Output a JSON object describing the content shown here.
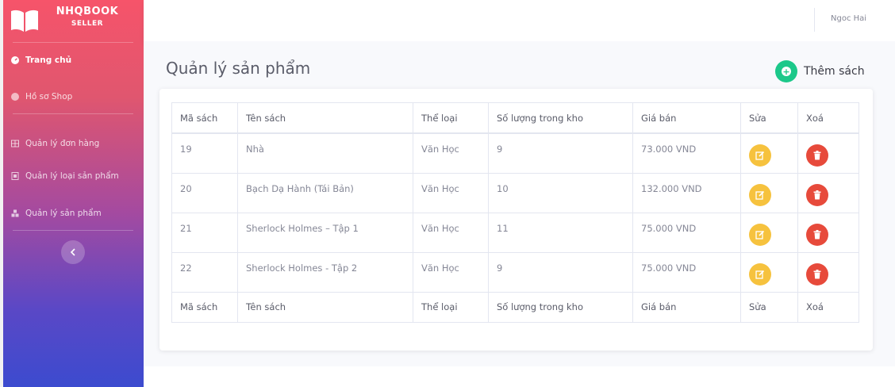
{
  "brand": {
    "name": "NHQBOOK",
    "sub": "SELLER"
  },
  "sidebar": {
    "items": [
      {
        "label": "Trang chủ",
        "icon": "dashboard-icon",
        "active": true
      },
      {
        "label": "Hồ sơ Shop",
        "icon": "profile-icon",
        "active": false
      },
      {
        "label": "Quản lý đơn hàng",
        "icon": "table-icon",
        "active": false
      },
      {
        "label": "Quản lý loại sản phẩm",
        "icon": "category-icon",
        "active": false
      },
      {
        "label": "Quản lý sản phẩm",
        "icon": "boxes-icon",
        "active": false
      }
    ],
    "collapse_icon": "chevron-left-icon"
  },
  "topbar": {
    "user_name": "Ngoc Hai"
  },
  "main": {
    "title": "Quản lý sản phẩm",
    "add_button": "Thêm sách",
    "table": {
      "columns": [
        "Mã sách",
        "Tên sách",
        "Thể loại",
        "Số lượng trong kho",
        "Giá bán",
        "Sửa",
        "Xoá"
      ],
      "rows": [
        [
          "19",
          "Nhà",
          "Văn Học",
          "9",
          "73.000 VND"
        ],
        [
          "20",
          "Bạch Dạ Hành (Tái Bản)",
          "Văn Học",
          "10",
          "132.000 VND"
        ],
        [
          "21",
          "Sherlock Holmes – Tập 1",
          "Văn Học",
          "11",
          "75.000 VND"
        ],
        [
          "22",
          "Sherlock Holmes - Tập 2",
          "Văn Học",
          "9",
          "75.000 VND"
        ]
      ]
    }
  },
  "colors": {
    "sidebar_top": "#f6546a",
    "sidebar_bottom": "#3c4bcf",
    "add_button": "#1cc88a",
    "edit_button": "#f6c23e",
    "delete_button": "#e74a3b"
  }
}
